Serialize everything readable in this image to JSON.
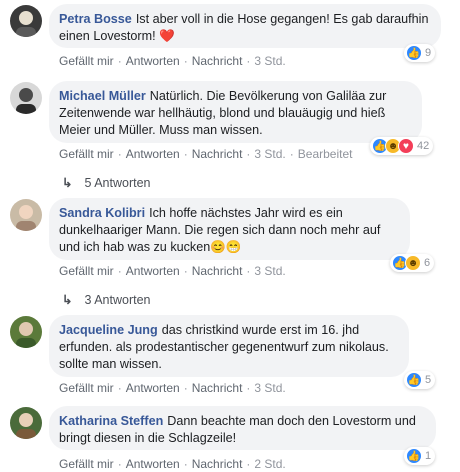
{
  "colors": {
    "link": "#385898",
    "bubble": "#f2f3f5",
    "like": "#2d88ff",
    "love": "#f33e58",
    "haha": "#f7b928"
  },
  "actions": {
    "like": "Gefällt mir",
    "reply": "Antworten",
    "message": "Nachricht",
    "separator": "·"
  },
  "comments": [
    {
      "author": "Petra Bosse",
      "text": "Ist aber voll in die Hose gegangen! Es gab daraufhin einen Lovestorm!",
      "emoji": "❤️",
      "reaction_count": "9",
      "time": "3 Std.",
      "reactions": [
        "like-icon"
      ]
    },
    {
      "author": "Michael Müller",
      "text": "Natürlich. Die Bevölkerung von Galiläa zur Zeitenwende war hellhäutig, blond und blauäugig und hieß Meier und Müller. Muss man wissen.",
      "reaction_count": "42",
      "time": "3 Std.",
      "edited": "Bearbeitet",
      "replies": "5 Antworten",
      "reactions": [
        "like-icon",
        "haha-icon",
        "love-icon"
      ]
    },
    {
      "author": "Sandra Kolibri",
      "text": "Ich hoffe nächstes Jahr wird es ein dunkelhaariger Mann. Die regen sich dann noch mehr auf und ich hab was zu kucken",
      "emoji": "😊😁",
      "reaction_count": "6",
      "time": "3 Std.",
      "replies": "3 Antworten",
      "reactions": [
        "like-icon",
        "haha-icon"
      ]
    },
    {
      "author": "Jacqueline Jung",
      "text": "das christkind wurde erst im 16. jhd erfunden. als prodestantischer gegenentwurf zum nikolaus. sollte man wissen.",
      "reaction_count": "5",
      "time": "3 Std.",
      "reactions": [
        "like-icon"
      ]
    },
    {
      "author": "Katharina Steffen",
      "text": "Dann beachte man doch den Lovestorm und bringt diesen in die Schlagzeile!",
      "reaction_count": "1",
      "time": "2 Std.",
      "reactions": [
        "like-icon"
      ]
    }
  ]
}
